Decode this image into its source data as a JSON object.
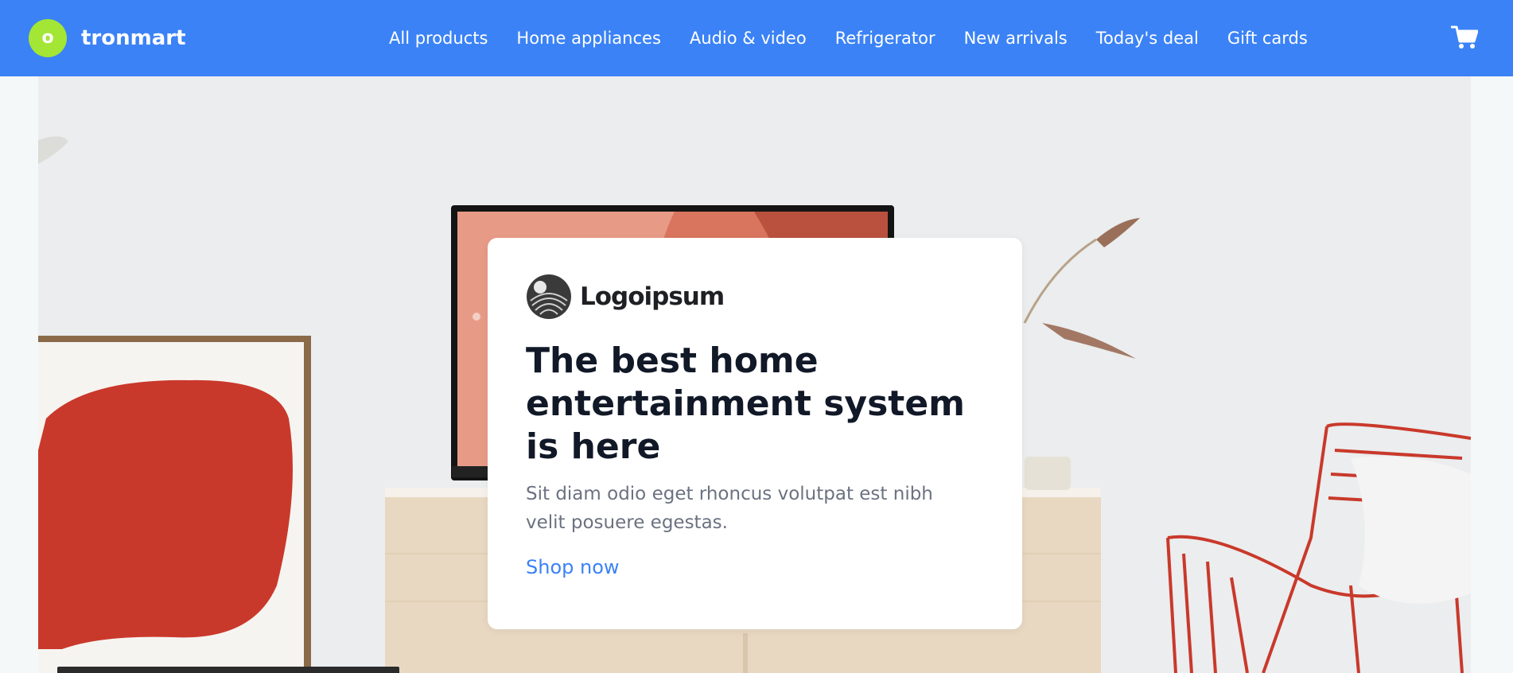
{
  "header": {
    "brand": {
      "logo_letter": "o",
      "name": "tronmart"
    },
    "nav": [
      {
        "label": "All products"
      },
      {
        "label": "Home appliances"
      },
      {
        "label": "Audio & video"
      },
      {
        "label": "Refrigerator"
      },
      {
        "label": "New arrivals"
      },
      {
        "label": "Today's deal"
      },
      {
        "label": "Gift cards"
      }
    ],
    "cart_icon": "shopping-cart-icon"
  },
  "hero": {
    "image": "living-room-tv-console-photo",
    "card": {
      "logo_text": "Logoipsum",
      "title": "The best home entertainment system is here",
      "description": "Sit diam odio eget rhoncus volutpat est nibh velit posuere egestas.",
      "cta": "Shop now"
    }
  },
  "colors": {
    "header_bg": "#3b82f6",
    "brand_logo": "#a3e635",
    "link": "#3b82f6",
    "title": "#111827",
    "body_text": "#6b7280"
  }
}
